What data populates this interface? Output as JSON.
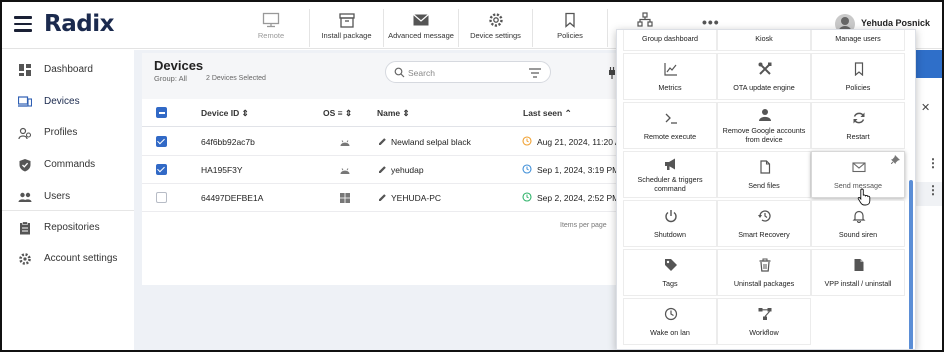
{
  "app": {
    "logo": "Radix"
  },
  "toolbar": {
    "items": [
      {
        "label": "Remote",
        "icon": "monitor-icon",
        "disabled": true
      },
      {
        "label": "Install package",
        "icon": "package-icon"
      },
      {
        "label": "Advanced message",
        "icon": "envelope-icon"
      },
      {
        "label": "Device settings",
        "icon": "gear-icon"
      },
      {
        "label": "Policies",
        "icon": "bookmark-icon"
      },
      {
        "label": "",
        "icon": "group-dashboard-icon"
      }
    ],
    "more": "•••"
  },
  "user": {
    "name": "Yehuda Posnick"
  },
  "sidebar": {
    "items": [
      {
        "label": "Dashboard",
        "icon": "dashboard-icon"
      },
      {
        "label": "Devices",
        "icon": "devices-icon",
        "active": true
      },
      {
        "label": "Profiles",
        "icon": "profiles-icon"
      },
      {
        "label": "Commands",
        "icon": "shield-icon"
      },
      {
        "label": "Users",
        "icon": "users-icon"
      },
      {
        "label": "Repositories",
        "icon": "clipboard-icon"
      },
      {
        "label": "Account settings",
        "icon": "gear-icon"
      }
    ]
  },
  "devices": {
    "title": "Devices",
    "group": "Group: All",
    "selected": "2 Devices Selected",
    "search_placeholder": "Search",
    "columns": {
      "device_id": "Device ID",
      "os": "OS",
      "name": "Name",
      "last_seen": "Last seen"
    },
    "rows": [
      {
        "id": "64f6bb92ac7b",
        "os": "android",
        "name": "Newland selpal black",
        "last_seen": "Aug 21, 2024, 11:20 A",
        "checked": true,
        "status_color": "#f0a030"
      },
      {
        "id": "HA195F3Y",
        "os": "android",
        "name": "yehudap",
        "last_seen": "Sep 1, 2024, 3:19 PM",
        "checked": true,
        "status_color": "#3f8fd8"
      },
      {
        "id": "64497DEFBE1A",
        "os": "windows",
        "name": "YEHUDA-PC",
        "last_seen": "Sep 2, 2024, 2:52 PM",
        "checked": false,
        "status_color": "#2fb36a"
      }
    ],
    "items_per_page": "Items per page"
  },
  "menu": {
    "tiles": [
      {
        "label": "Group dashboard",
        "icon": "none"
      },
      {
        "label": "Kiosk",
        "icon": "none"
      },
      {
        "label": "Manage users",
        "icon": "none"
      },
      {
        "label": "Metrics",
        "icon": "chart-line-icon"
      },
      {
        "label": "OTA update engine",
        "icon": "tools-icon"
      },
      {
        "label": "Policies",
        "icon": "bookmark-icon"
      },
      {
        "label": "Remote execute",
        "icon": "terminal-icon"
      },
      {
        "label": "Remove Google accounts from device",
        "icon": "person-icon"
      },
      {
        "label": "Restart",
        "icon": "refresh-icon"
      },
      {
        "label": "Scheduler & triggers command",
        "icon": "megaphone-icon"
      },
      {
        "label": "Send files",
        "icon": "file-icon"
      },
      {
        "label": "Send message",
        "icon": "envelope-icon",
        "hover": true
      },
      {
        "label": "Shutdown",
        "icon": "power-icon"
      },
      {
        "label": "Smart Recovery",
        "icon": "history-icon"
      },
      {
        "label": "Sound siren",
        "icon": "bell-icon"
      },
      {
        "label": "Tags",
        "icon": "tag-icon"
      },
      {
        "label": "Uninstall packages",
        "icon": "trash-icon"
      },
      {
        "label": "VPP install / uninstall",
        "icon": "document-icon"
      },
      {
        "label": "Wake on lan",
        "icon": "clock-icon"
      },
      {
        "label": "Workflow",
        "icon": "workflow-icon"
      }
    ]
  },
  "colors": {
    "brand": "#1b2a4e",
    "accent": "#3169c6",
    "menu_scroll": "#5b8ed6"
  }
}
